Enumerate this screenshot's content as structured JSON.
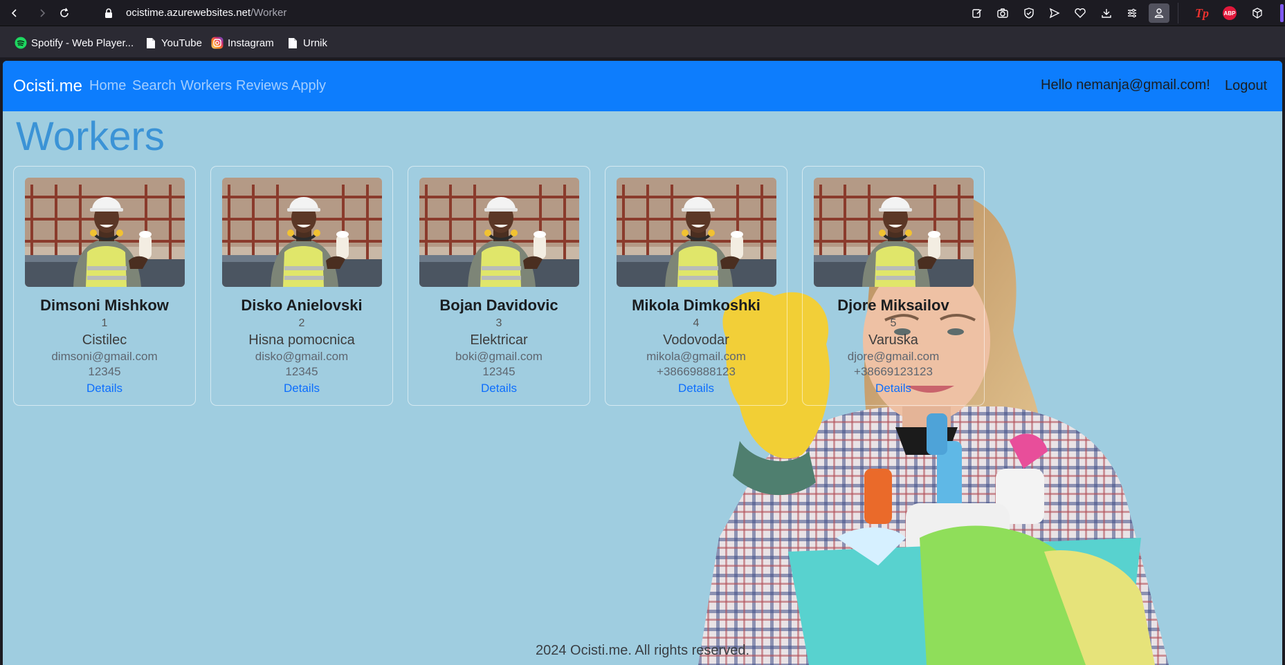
{
  "browser": {
    "url_domain": "ocistime.azurewebsites.net",
    "url_path": "/Worker",
    "bookmarks": [
      {
        "label": "Spotify - Web Player...",
        "icon": "spotify-icon"
      },
      {
        "label": "YouTube",
        "icon": "page-icon"
      },
      {
        "label": "Instagram",
        "icon": "instagram-icon"
      },
      {
        "label": "Urnik",
        "icon": "page-icon"
      }
    ],
    "extensions": {
      "tp": "Tp",
      "abp": "ABP"
    }
  },
  "navbar": {
    "brand": "Ocisti.me",
    "links": [
      "Home",
      "Search",
      "Workers",
      "Reviews",
      "Apply"
    ],
    "greeting": "Hello nemanja@gmail.com!",
    "logout": "Logout"
  },
  "page": {
    "heading": "Workers",
    "footer": "2024 Ocisti.me. All rights reserved."
  },
  "workers": [
    {
      "name": "Dimsoni Mishkow",
      "id": "1",
      "role": "Cistilec",
      "email": "dimsoni@gmail.com",
      "phone": "12345",
      "details": "Details"
    },
    {
      "name": "Disko Anielovski",
      "id": "2",
      "role": "Hisna pomocnica",
      "email": "disko@gmail.com",
      "phone": "12345",
      "details": "Details"
    },
    {
      "name": "Bojan Davidovic",
      "id": "3",
      "role": "Elektricar",
      "email": "boki@gmail.com",
      "phone": "12345",
      "details": "Details"
    },
    {
      "name": "Mikola Dimkoshki",
      "id": "4",
      "role": "Vodovodar",
      "email": "mikola@gmail.com",
      "phone": "+38669888123",
      "details": "Details"
    },
    {
      "name": "Djore Miksailov",
      "id": "5",
      "role": "Varuska",
      "email": "djore@gmail.com",
      "phone": "+38669123123",
      "details": "Details"
    }
  ],
  "colors": {
    "navbar": "#0d7dfd",
    "page_bg": "#9fcde0",
    "heading": "#3b93d6",
    "link": "#0d6efd"
  }
}
